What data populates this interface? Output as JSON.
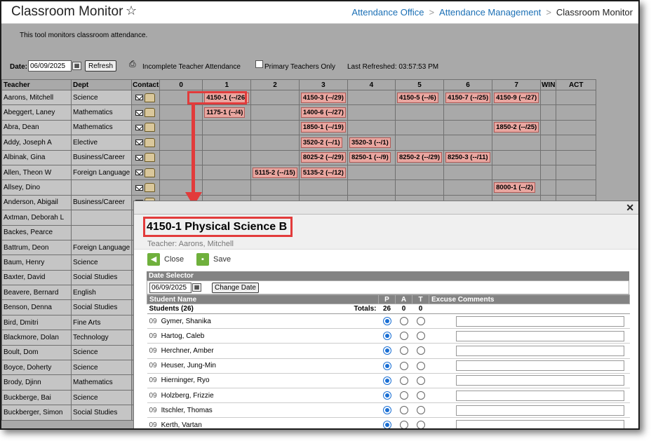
{
  "header": {
    "title": "Classroom Monitor",
    "breadcrumb": [
      "Attendance Office",
      "Attendance Management",
      "Classroom Monitor"
    ]
  },
  "description": "This tool monitors classroom attendance.",
  "toolbar": {
    "date_label": "Date:",
    "date_value": "06/09/2025",
    "refresh_label": "Refresh",
    "incomplete_label": "Incomplete Teacher Attendance",
    "primary_label": "Primary Teachers Only",
    "last_refreshed": "Last Refreshed: 03:57:53 PM"
  },
  "grid": {
    "columns": [
      "Teacher",
      "Dept",
      "Contact",
      "0",
      "1",
      "2",
      "3",
      "4",
      "5",
      "6",
      "7",
      "WIN",
      "ACT"
    ],
    "rows": [
      {
        "teacher": "Aarons, Mitchell",
        "dept": "Science",
        "p": [
          "",
          "4150-1 (--/26)",
          "",
          "4150-3 (--/29)",
          "",
          "4150-5 (--/6)",
          "4150-7 (--/25)",
          "4150-9 (--/27)",
          "",
          ""
        ]
      },
      {
        "teacher": "Abeggert, Laney",
        "dept": "Mathematics",
        "p": [
          "",
          "1175-1 (--/4)",
          "",
          "1400-6 (--/27)",
          "",
          "",
          "",
          "",
          "",
          ""
        ]
      },
      {
        "teacher": "Abra, Dean",
        "dept": "Mathematics",
        "p": [
          "",
          "",
          "",
          "1850-1 (--/19)",
          "",
          "",
          "",
          "1850-2 (--/25)",
          "",
          ""
        ]
      },
      {
        "teacher": "Addy, Joseph A",
        "dept": "Elective",
        "p": [
          "",
          "",
          "",
          "3520-2 (--/1)",
          "3520-3 (--/1)",
          "",
          "",
          "",
          "",
          ""
        ]
      },
      {
        "teacher": "Albinak, Gina",
        "dept": "Business/Career",
        "p": [
          "",
          "",
          "",
          "8025-2 (--/29)",
          "8250-1 (--/9)",
          "8250-2 (--/29)",
          "8250-3 (--/11)",
          "",
          "",
          ""
        ]
      },
      {
        "teacher": "Allen, Theon W",
        "dept": "Foreign Language",
        "p": [
          "",
          "",
          "5115-2 (--/15)",
          "5135-2 (--/12)",
          "",
          "",
          "",
          "",
          "",
          ""
        ]
      },
      {
        "teacher": "Allsey, Dino",
        "dept": "",
        "p": [
          "",
          "",
          "",
          "",
          "",
          "",
          "",
          "8000-1 (--/2)",
          "",
          ""
        ]
      },
      {
        "teacher": "Anderson, Abigail",
        "dept": "Business/Career",
        "p": []
      },
      {
        "teacher": "Axtman, Deborah L",
        "dept": "",
        "p": []
      },
      {
        "teacher": "Backes, Pearce",
        "dept": "",
        "p": []
      },
      {
        "teacher": "Battrum, Deon",
        "dept": "Foreign Language",
        "p": []
      },
      {
        "teacher": "Baum, Henry",
        "dept": "Science",
        "p": []
      },
      {
        "teacher": "Baxter, David",
        "dept": "Social Studies",
        "p": []
      },
      {
        "teacher": "Beavere, Bernard",
        "dept": "English",
        "p": []
      },
      {
        "teacher": "Benson, Denna",
        "dept": "Social Studies",
        "p": []
      },
      {
        "teacher": "Bird, Dmitri",
        "dept": "Fine Arts",
        "p": []
      },
      {
        "teacher": "Blackmore, Dolan",
        "dept": "Technology",
        "p": []
      },
      {
        "teacher": "Boult, Dom",
        "dept": "Science",
        "p": []
      },
      {
        "teacher": "Boyce, Doherty",
        "dept": "Science",
        "p": []
      },
      {
        "teacher": "Brody, Djinn",
        "dept": "Mathematics",
        "p": []
      },
      {
        "teacher": "Buckberge, Bai",
        "dept": "Science",
        "p": []
      },
      {
        "teacher": "Buckberger, Simon",
        "dept": "Social Studies",
        "p": []
      }
    ]
  },
  "modal": {
    "title": "4150-1 Physical Science B",
    "teacher": "Teacher: Aarons, Mitchell",
    "close_label": "Close",
    "save_label": "Save",
    "date_selector": "Date Selector",
    "date_value": "06/09/2025",
    "change_date": "Change Date",
    "columns": {
      "name": "Student Name",
      "p": "P",
      "a": "A",
      "t": "T",
      "comments": "Excuse Comments"
    },
    "students_label": "Students (26)",
    "totals_label": "Totals:",
    "totals": {
      "p": "26",
      "a": "0",
      "t": "0"
    },
    "students": [
      {
        "grade": "09",
        "name": "Gymer, Shanika"
      },
      {
        "grade": "09",
        "name": "Hartog, Caleb"
      },
      {
        "grade": "09",
        "name": "Herchner, Amber"
      },
      {
        "grade": "09",
        "name": "Heuser, Jung-Min"
      },
      {
        "grade": "09",
        "name": "Hierninger, Ryo"
      },
      {
        "grade": "09",
        "name": "Holzberg, Frizzie"
      },
      {
        "grade": "09",
        "name": "Itschler, Thomas"
      },
      {
        "grade": "09",
        "name": "Kerth, Vartan"
      }
    ]
  },
  "colors": {
    "section_bg": "#e9a6a0",
    "highlight": "#e23b3b",
    "link": "#1a6fb5"
  }
}
